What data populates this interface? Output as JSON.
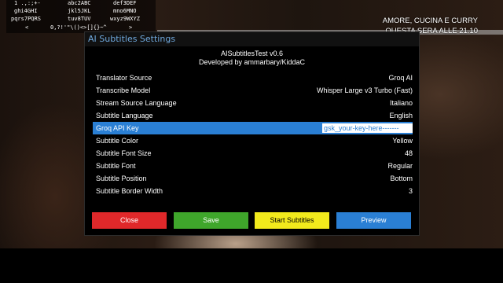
{
  "keypad": {
    "keys": [
      "1 .,:;+-",
      "abc2ABC",
      "def3DEF",
      "ghi4GHI",
      "jkl5JKL",
      "mno6MNO",
      "pqrs7PQRS",
      "tuv8TUV",
      "wxyz9WXYZ",
      "<",
      "0,?!'\"\\()<>[]{}~^",
      ">"
    ]
  },
  "channel_info": {
    "line1": "AMORE, CUCINA E CURRY",
    "line2": "QUESTA SERA ALLE 21.10"
  },
  "dialog": {
    "title": "AI Subtitles Settings",
    "app_name": "AISubtitlesTest v0.6",
    "author": "Developed by ammarbary/KiddaC",
    "settings": [
      {
        "label": "Translator Source",
        "value": "Groq AI"
      },
      {
        "label": "Transcribe Model",
        "value": "Whisper Large v3 Turbo (Fast)"
      },
      {
        "label": "Stream Source Language",
        "value": "Italiano"
      },
      {
        "label": "Subtitle Language",
        "value": "English"
      },
      {
        "label": "Groq API Key",
        "value": "gsk_your-key-here-------"
      },
      {
        "label": "Subtitle Color",
        "value": "Yellow"
      },
      {
        "label": "Subtitle Font Size",
        "value": "48"
      },
      {
        "label": "Subtitle Font",
        "value": "Regular"
      },
      {
        "label": "Subtitle Position",
        "value": "Bottom"
      },
      {
        "label": "Subtitle Border Width",
        "value": "3"
      }
    ],
    "selected_index": 4,
    "buttons": {
      "close": "Close",
      "save": "Save",
      "start": "Start Subtitles",
      "preview": "Preview"
    }
  },
  "colors": {
    "accent_blue": "#2a7fd4",
    "red": "#e0282a",
    "green": "#3fa62b",
    "yellow": "#f2ea1c",
    "title_blue": "#6fa8dc"
  }
}
